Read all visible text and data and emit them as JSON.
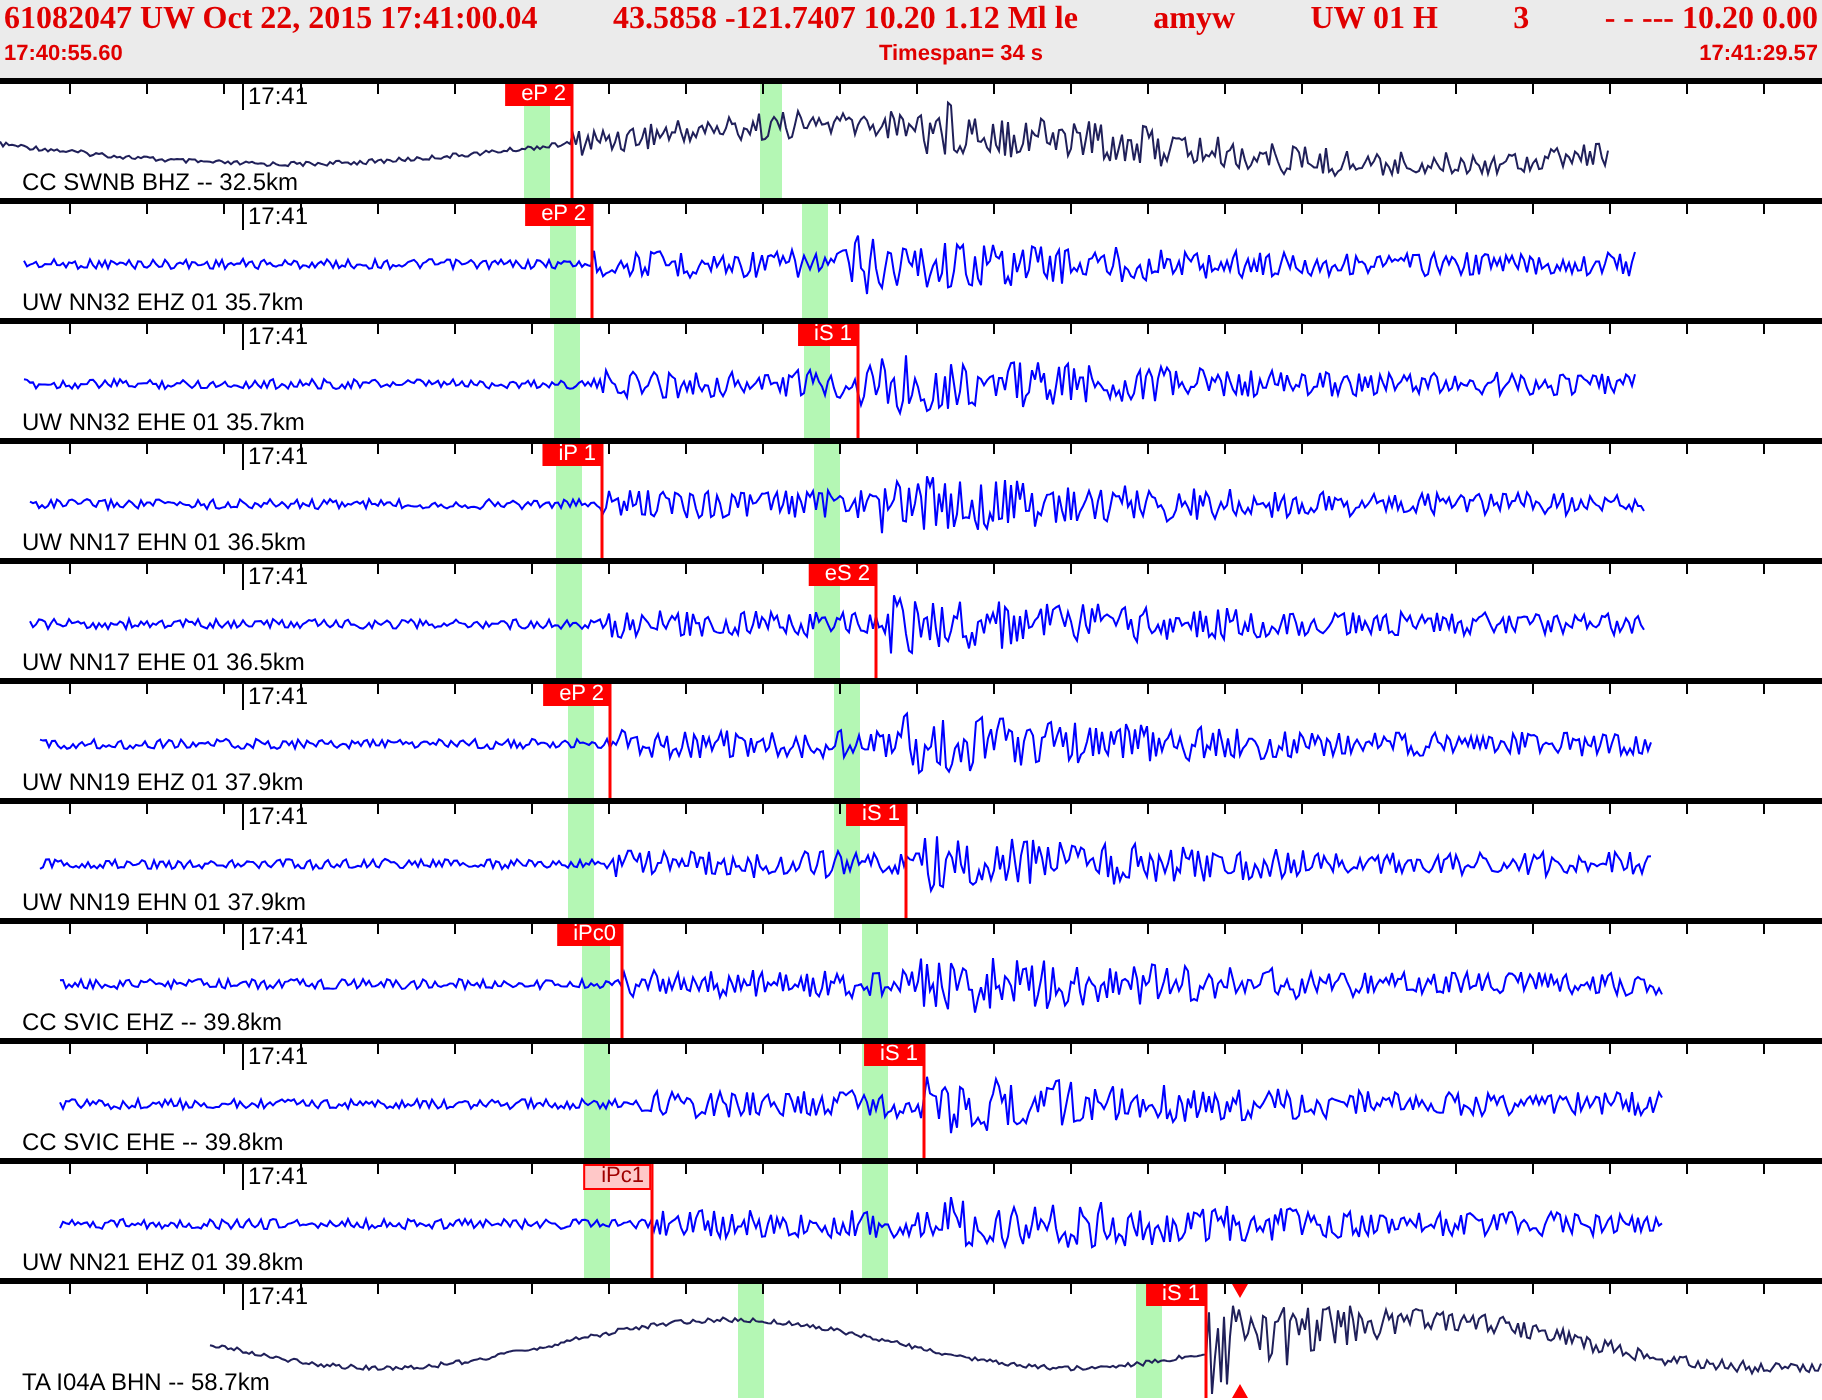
{
  "header": {
    "fields": [
      "61082047 UW Oct 22, 2015 17:41:00.04",
      "43.5858 -121.7407 10.20 1.12 Ml le",
      "amyw",
      "UW 01 H",
      "3",
      "- - --- 10.20 0.00"
    ],
    "start_time": "17:40:55.60",
    "timespan": "Timespan=  34 s",
    "end_time": "17:41:29.57"
  },
  "traces": [
    {
      "label": "CC SWNB BHZ -- 32.5km",
      "time": "17:41",
      "color": "#20205a",
      "picks": [
        {
          "label": "eP 2",
          "kind": "solid"
        }
      ]
    },
    {
      "label": "UW NN32 EHZ 01 35.7km",
      "time": "17:41",
      "color": "#0000ff",
      "picks": [
        {
          "label": "eP 2",
          "kind": "solid"
        }
      ]
    },
    {
      "label": "UW NN32 EHE 01 35.7km",
      "time": "17:41",
      "color": "#0000ff",
      "picks": [
        {
          "label": "iS 1",
          "kind": "solid"
        }
      ]
    },
    {
      "label": "UW NN17 EHN 01 36.5km",
      "time": "17:41",
      "color": "#0000ff",
      "picks": [
        {
          "label": "iP 1",
          "kind": "solid"
        }
      ]
    },
    {
      "label": "UW NN17 EHE 01 36.5km",
      "time": "17:41",
      "color": "#0000ff",
      "picks": [
        {
          "label": "eS 2",
          "kind": "solid"
        }
      ]
    },
    {
      "label": "UW NN19 EHZ 01 37.9km",
      "time": "17:41",
      "color": "#0000ff",
      "picks": [
        {
          "label": "eP 2",
          "kind": "solid"
        }
      ]
    },
    {
      "label": "UW NN19 EHN 01 37.9km",
      "time": "17:41",
      "color": "#0000ff",
      "picks": [
        {
          "label": "iS 1",
          "kind": "solid"
        }
      ]
    },
    {
      "label": "CC SVIC EHZ -- 39.8km",
      "time": "17:41",
      "color": "#0000ff",
      "picks": [
        {
          "label": "iPc0",
          "kind": "solid"
        }
      ]
    },
    {
      "label": "CC SVIC EHE -- 39.8km",
      "time": "17:41",
      "color": "#0000ff",
      "picks": [
        {
          "label": "iS 1",
          "kind": "solid"
        }
      ]
    },
    {
      "label": "UW NN21 EHZ 01 39.8km",
      "time": "17:41",
      "color": "#0000ff",
      "picks": [
        {
          "label": "iPc1",
          "kind": "outline"
        }
      ]
    },
    {
      "label": "TA I04A BHN -- 58.7km",
      "time": "17:41",
      "color": "#20205a",
      "picks": [
        {
          "label": "iS 1",
          "kind": "solid"
        }
      ]
    }
  ]
}
